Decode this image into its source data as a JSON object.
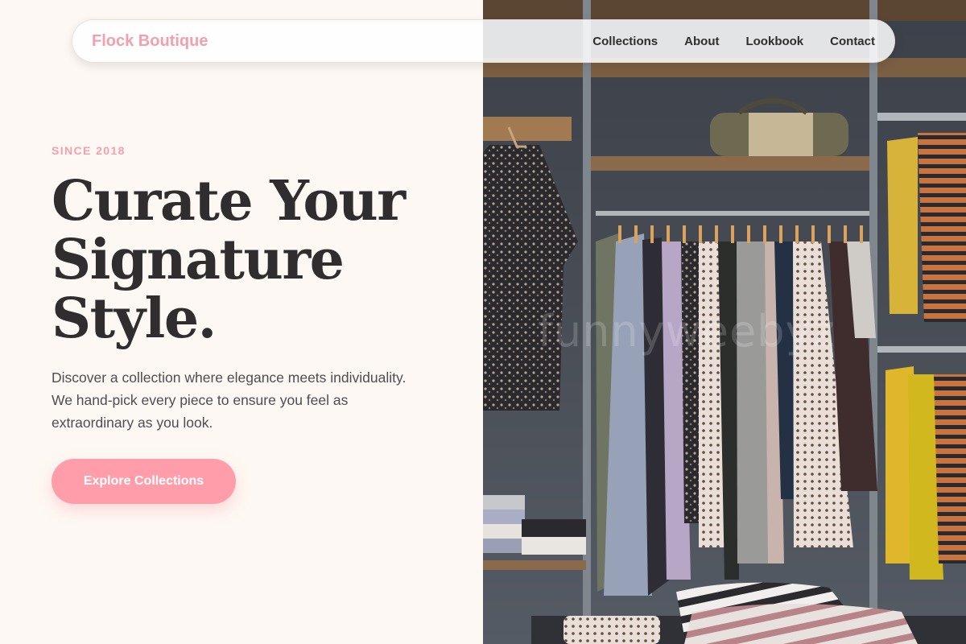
{
  "nav": {
    "brand": "Flock Boutique",
    "links": [
      "Collections",
      "About",
      "Lookbook",
      "Contact"
    ]
  },
  "hero": {
    "eyebrow": "SINCE 2018",
    "headline_lines": [
      "Curate Your",
      "Signature",
      "Style."
    ],
    "description": "Discover a collection where elegance meets individuality. We hand-pick every piece to ensure you feel as extraordinary as you look.",
    "cta_label": "Explore Collections"
  },
  "image": {
    "watermark": "funnyweebyz"
  },
  "colors": {
    "accent_pink": "#ff9eaa",
    "brand_pink": "#f2a0ae",
    "background": "#fdf8f3",
    "text_dark": "#2f2d2e"
  }
}
